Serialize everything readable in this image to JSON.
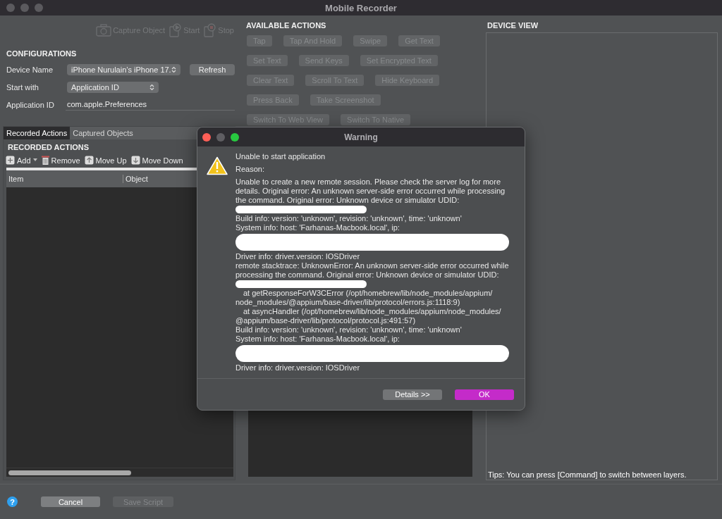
{
  "window": {
    "title": "Mobile Recorder"
  },
  "toolbar": [
    {
      "label": "Capture Object",
      "kind": "camera",
      "disabled": true
    },
    {
      "label": "Start",
      "kind": "start",
      "disabled": true
    },
    {
      "label": "Stop",
      "kind": "stop",
      "disabled": true
    }
  ],
  "configurations": {
    "heading": "CONFIGURATIONS",
    "device_name": {
      "label": "Device Name",
      "value": "iPhone Nurulain’s iPhone 17.",
      "button": "Refresh"
    },
    "start_with": {
      "label": "Start with",
      "value": "Application ID"
    },
    "application_id": {
      "label": "Application ID",
      "value": "com.apple.Preferences"
    }
  },
  "tabs": [
    {
      "label": "Recorded Actions",
      "selected": true
    },
    {
      "label": "Captured Objects",
      "selected": false
    }
  ],
  "recorded_actions": {
    "heading": "RECORDED ACTIONS",
    "tools": [
      {
        "label": "Add",
        "kind": "add"
      },
      {
        "label": "Remove",
        "kind": "remove"
      },
      {
        "label": "Move Up",
        "kind": "up"
      },
      {
        "label": "Move Down",
        "kind": "down"
      }
    ],
    "columns": [
      "Item",
      "Object"
    ]
  },
  "available_actions": {
    "heading": "AVAILABLE ACTIONS",
    "rows": [
      [
        {
          "label": "Tap",
          "disabled": true
        },
        {
          "label": "Tap And Hold",
          "disabled": true
        },
        {
          "label": "Swipe",
          "disabled": true
        },
        {
          "label": "Get Text",
          "disabled": true
        }
      ],
      [
        {
          "label": "Set Text",
          "disabled": true
        },
        {
          "label": "Send Keys",
          "disabled": true
        },
        {
          "label": "Set Encrypted Text",
          "disabled": true
        }
      ],
      [
        {
          "label": "Clear Text",
          "disabled": true
        },
        {
          "label": "Scroll To Text",
          "disabled": true
        },
        {
          "label": "Hide Keyboard",
          "disabled": true
        }
      ],
      [
        {
          "label": "Press Back",
          "disabled": true
        },
        {
          "label": "Take Screenshot",
          "disabled": true
        }
      ],
      [
        {
          "label": "Switch To Web View",
          "disabled": true
        },
        {
          "label": "Switch To Native",
          "disabled": true
        }
      ]
    ]
  },
  "device_view": {
    "heading": "DEVICE VIEW",
    "tip": "Tips: You can press [Command] to switch between layers."
  },
  "footer": {
    "help": "?",
    "buttons": [
      {
        "label": "Cancel",
        "disabled": false
      },
      {
        "label": "Save Script",
        "disabled": true
      }
    ]
  },
  "dialog": {
    "title": "Warning",
    "blocks": [
      {
        "kind": "heading",
        "text": "Unable to start application"
      },
      {
        "kind": "heading",
        "text": "Reason:"
      },
      {
        "kind": "text",
        "text": "Unable to create a new remote session. Please check the server log for more details. Original error: An unknown server-side error occurred while processing the command. Original error: Unknown device or simulator UDID:"
      },
      {
        "kind": "redaction",
        "wide": false
      },
      {
        "kind": "text",
        "text": "Build info: version: 'unknown', revision: 'unknown', time: 'unknown'"
      },
      {
        "kind": "text",
        "text": "System info: host: 'Farhanas-Macbook.local', ip:"
      },
      {
        "kind": "redaction",
        "wide": true
      },
      {
        "kind": "text",
        "text": "Driver info: driver.version: IOSDriver"
      },
      {
        "kind": "text",
        "text": "remote stacktrace: UnknownError: An unknown server-side error occurred while processing the command. Original error: Unknown device or simulator UDID:"
      },
      {
        "kind": "redaction",
        "wide": false
      },
      {
        "kind": "stack",
        "text": "at getResponseForW3CError (/opt/homebrew/lib/node_modules/appium/ node_modules/@appium/base-driver/lib/protocol/errors.js:1118:9)"
      },
      {
        "kind": "stack",
        "text": "at asyncHandler (/opt/homebrew/lib/node_modules/appium/node_modules/ @appium/base-driver/lib/protocol/protocol.js:491:57)"
      },
      {
        "kind": "text",
        "text": "Build info: version: 'unknown', revision: 'unknown', time: 'unknown'"
      },
      {
        "kind": "text",
        "text": "System info: host: 'Farhanas-Macbook.local', ip:"
      },
      {
        "kind": "redaction",
        "wide": true
      },
      {
        "kind": "text",
        "text": "Driver info: driver.version: IOSDriver"
      }
    ],
    "buttons": [
      {
        "label": "Details >>",
        "kind": "secondary"
      },
      {
        "label": "OK",
        "kind": "primary"
      }
    ]
  }
}
